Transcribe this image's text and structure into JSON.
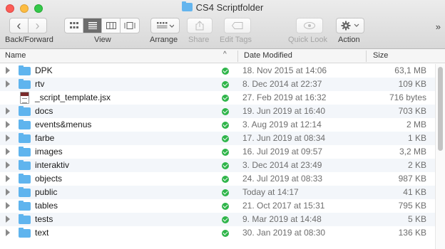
{
  "window": {
    "title": "CS4 Scriptfolder"
  },
  "toolbar": {
    "back_forward_label": "Back/Forward",
    "view_label": "View",
    "arrange_label": "Arrange",
    "share_label": "Share",
    "edit_tags_label": "Edit Tags",
    "quick_look_label": "Quick Look",
    "action_label": "Action",
    "back_glyph": "‹",
    "forward_glyph": "›",
    "overflow_glyph": "»"
  },
  "columns": {
    "name": "Name",
    "date_modified": "Date Modified",
    "size": "Size",
    "sort_glyph": "^"
  },
  "files": [
    {
      "name": "DPK",
      "kind": "folder",
      "date": "18. Nov 2015 at 14:06",
      "size": "63,1 MB"
    },
    {
      "name": "rtv",
      "kind": "folder",
      "date": "8. Dec 2014 at 22:37",
      "size": "109 KB"
    },
    {
      "name": "_script_template.jsx",
      "kind": "file",
      "date": "27. Feb 2019 at 16:32",
      "size": "716 bytes"
    },
    {
      "name": "docs",
      "kind": "folder",
      "date": "19. Jun 2019 at 16:40",
      "size": "703 KB"
    },
    {
      "name": "events&menus",
      "kind": "folder",
      "date": "3. Aug 2019 at 12:14",
      "size": "2 MB"
    },
    {
      "name": "farbe",
      "kind": "folder",
      "date": "17. Jun 2019 at 08:34",
      "size": "1 KB"
    },
    {
      "name": "images",
      "kind": "folder",
      "date": "16. Jul 2019 at 09:57",
      "size": "3,2 MB"
    },
    {
      "name": "interaktiv",
      "kind": "folder",
      "date": "3. Dec 2014 at 23:49",
      "size": "2 KB"
    },
    {
      "name": "objects",
      "kind": "folder",
      "date": "24. Jul 2019 at 08:33",
      "size": "987 KB"
    },
    {
      "name": "public",
      "kind": "folder",
      "date": "Today at 14:17",
      "size": "41 KB"
    },
    {
      "name": "tables",
      "kind": "folder",
      "date": "21. Oct 2017 at 15:31",
      "size": "795 KB"
    },
    {
      "name": "tests",
      "kind": "folder",
      "date": "9. Mar 2019 at 14:48",
      "size": "5 KB"
    },
    {
      "name": "text",
      "kind": "folder",
      "date": "30. Jan 2019 at 08:30",
      "size": "136 KB"
    }
  ],
  "colors": {
    "folder": "#5fb4ee",
    "sync_ok": "#2fb54a",
    "row_alt": "#f3f6fa"
  }
}
